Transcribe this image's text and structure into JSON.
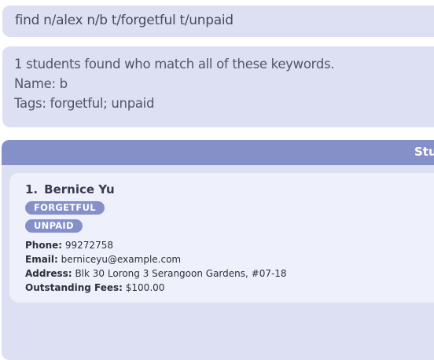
{
  "command": {
    "value": "find n/alex n/b t/forgetful t/unpaid"
  },
  "result": {
    "lines": [
      "1 students found who match all of these keywords.",
      "Name: b",
      "Tags: forgetful; unpaid"
    ]
  },
  "student_list": {
    "header": "Stu",
    "students": [
      {
        "index": "1.",
        "name": "Bernice Yu",
        "tags": [
          "FORGETFUL",
          "UNPAID"
        ],
        "phone_label": "Phone:",
        "phone": "99272758",
        "email_label": "Email:",
        "email": "berniceyu@example.com",
        "address_label": "Address:",
        "address": "Blk 30 Lorong 3 Serangoon Gardens, #07-18",
        "fees_label": "Outstanding Fees:",
        "fees": "$100.00"
      }
    ]
  },
  "colors": {
    "panel_background": "#dde0f3",
    "accent": "#8690c8",
    "card_background": "#eef0fb"
  }
}
